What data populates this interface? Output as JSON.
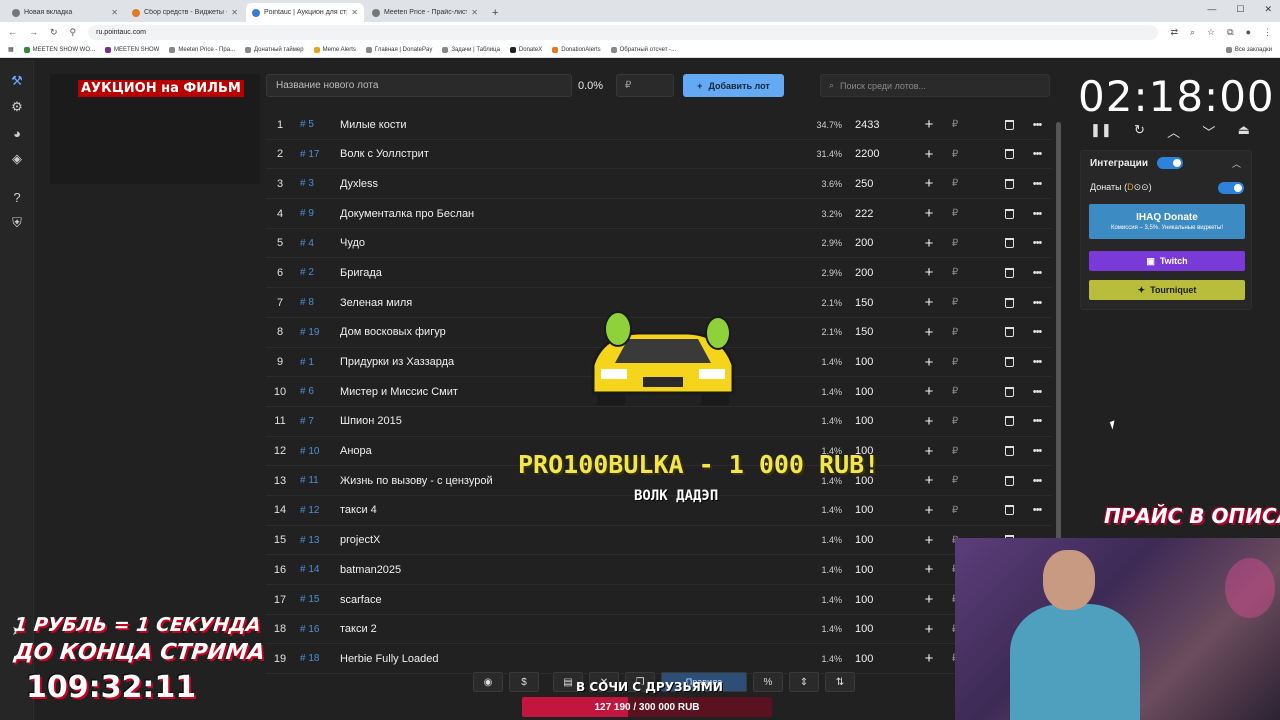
{
  "browser": {
    "tabs": [
      {
        "title": "Новая вкладка"
      },
      {
        "title": "Сбор средств - Виджеты - Do"
      },
      {
        "title": "Pointauc | Аукцион для стрим"
      },
      {
        "title": "Meeten Price - Прайс-лист стр"
      }
    ],
    "new_tab": "+",
    "url": "ru.pointauc.com",
    "bookmarks": [
      "MEETEN SHOW WO...",
      "MEETEN SHOW",
      "Meeten Price - Пра...",
      "Донатный таймер",
      "Meme Alerts",
      "Главная | DonatePay",
      "Задачи | Таблица",
      "DonateX",
      "DonationAlerts",
      "Обратный отсчет -..."
    ],
    "bookmarks_right": "Все закладки"
  },
  "auction": {
    "title": "АУКЦИОН на ФИЛЬМ",
    "new_lot_placeholder": "Название нового лота",
    "new_lot_percent": "0.0%",
    "amount_placeholder": "₽",
    "add_lot_label": "Добавить лот",
    "search_placeholder": "Поиск среди лотов...",
    "lots": [
      {
        "index": "1",
        "num": "# 5",
        "name": "Милые кости",
        "percent": "34.7%",
        "value": "2433"
      },
      {
        "index": "2",
        "num": "# 17",
        "name": "Волк с Уоллстрит",
        "percent": "31.4%",
        "value": "2200"
      },
      {
        "index": "3",
        "num": "# 3",
        "name": "Дyxless",
        "percent": "3.6%",
        "value": "250"
      },
      {
        "index": "4",
        "num": "# 9",
        "name": "Документалка про Беслан",
        "percent": "3.2%",
        "value": "222"
      },
      {
        "index": "5",
        "num": "# 4",
        "name": "Чудо",
        "percent": "2.9%",
        "value": "200"
      },
      {
        "index": "6",
        "num": "# 2",
        "name": "Бригада",
        "percent": "2.9%",
        "value": "200"
      },
      {
        "index": "7",
        "num": "# 8",
        "name": "Зеленая миля",
        "percent": "2.1%",
        "value": "150"
      },
      {
        "index": "8",
        "num": "# 19",
        "name": "Дом восковых фигур",
        "percent": "2.1%",
        "value": "150"
      },
      {
        "index": "9",
        "num": "# 1",
        "name": "Придурки из Хаззарда",
        "percent": "1.4%",
        "value": "100"
      },
      {
        "index": "10",
        "num": "# 6",
        "name": "Мистер и Миссис Смит",
        "percent": "1.4%",
        "value": "100"
      },
      {
        "index": "11",
        "num": "# 7",
        "name": "Шпион 2015",
        "percent": "1.4%",
        "value": "100"
      },
      {
        "index": "12",
        "num": "# 10",
        "name": "Анора",
        "percent": "1.4%",
        "value": "100"
      },
      {
        "index": "13",
        "num": "# 11",
        "name": "Жизнь по вызову - с цензурой",
        "percent": "1.4%",
        "value": "100"
      },
      {
        "index": "14",
        "num": "# 12",
        "name": "такси 4",
        "percent": "1.4%",
        "value": "100"
      },
      {
        "index": "15",
        "num": "# 13",
        "name": "projectX",
        "percent": "1.4%",
        "value": "100"
      },
      {
        "index": "16",
        "num": "# 14",
        "name": "batman2025",
        "percent": "1.4%",
        "value": "100"
      },
      {
        "index": "17",
        "num": "# 15",
        "name": "scarface",
        "percent": "1.4%",
        "value": "100"
      },
      {
        "index": "18",
        "num": "# 16",
        "name": "такси 2",
        "percent": "1.4%",
        "value": "100"
      },
      {
        "index": "19",
        "num": "# 18",
        "name": "Herbie Fully Loaded",
        "percent": "1.4%",
        "value": "100"
      }
    ],
    "currency_symbol": "₽",
    "plus": "+",
    "more": "•••"
  },
  "timer": {
    "value": "02:18:00"
  },
  "integrations": {
    "title": "Интеграции",
    "donates_label": "Донаты (",
    "donates_suffix": ")",
    "ihaq_title": "IHAQ Donate",
    "ihaq_subtitle": "Комиссия – 3,5%. Уникальные виджеты!",
    "twitch": "Twitch",
    "tourniquet": "Tourniquet"
  },
  "overlay": {
    "donation_name": "PRO100BULKA - 1 000 RUB!",
    "donation_message": "ВОЛК ДАДЭП",
    "price_banner": "ПРАЙС В ОПИСАНИИ",
    "rub_banner": "1 РУБЛЬ = 1 СЕКУНДА",
    "stream_end": "ДО КОНЦА СТРИМА",
    "stream_timer": "109:32:11",
    "caption": "В СОЧИ С ДРУЗЬЯМИ",
    "rules_label": "Правила",
    "goal_text": "127 190 / 300 000 RUB",
    "goal_fraction": 0.424
  },
  "colors": {
    "accent": "#64a9f3",
    "title_bg": "#b80000",
    "twitch": "#7a3ad8",
    "tourniquet": "#b9bd3c",
    "ihaq": "#3d8bc3"
  }
}
